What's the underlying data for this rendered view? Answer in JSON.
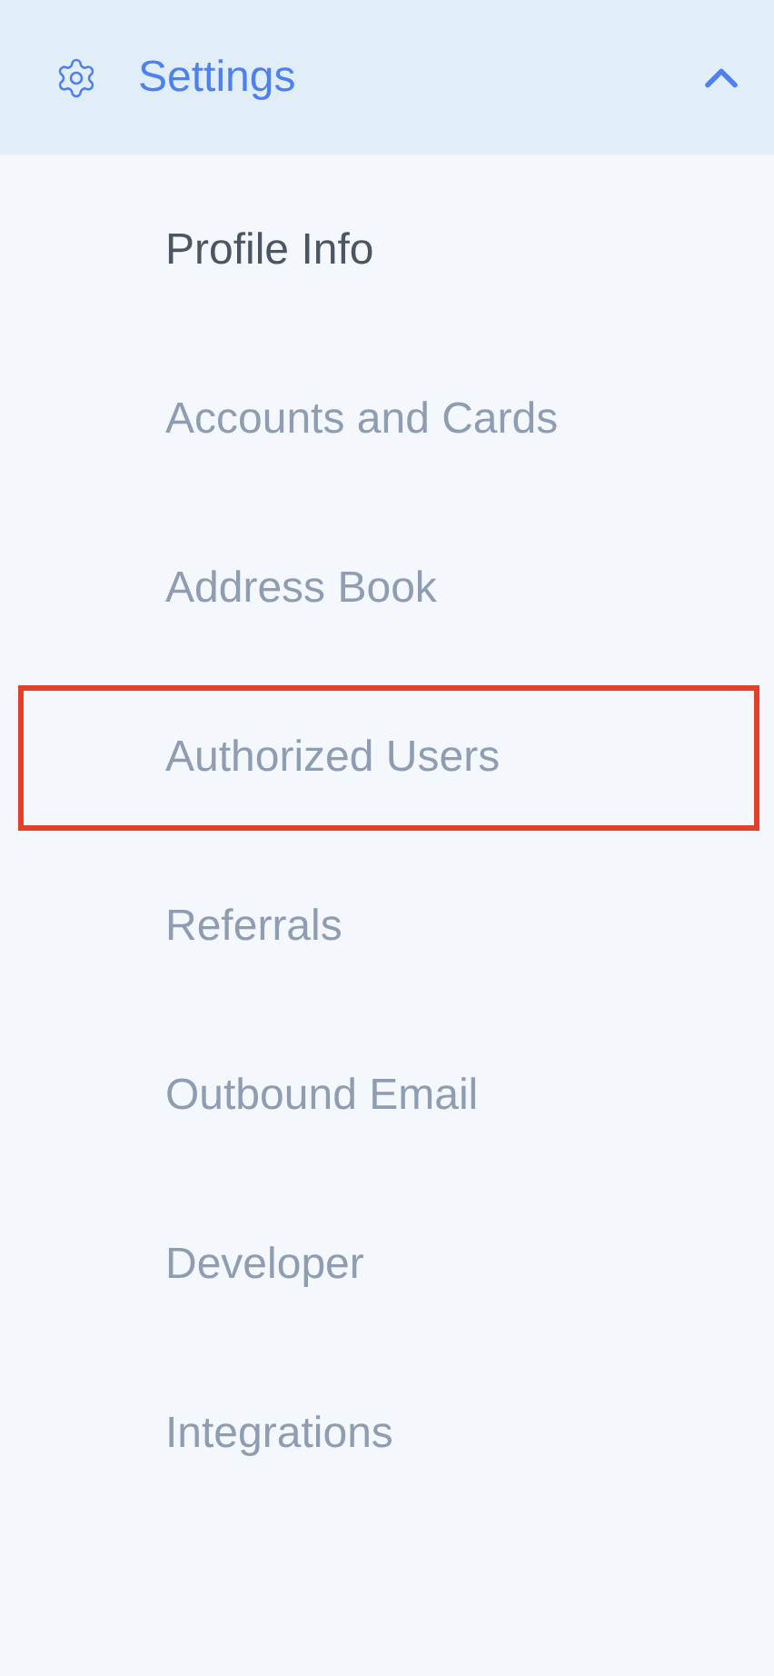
{
  "header": {
    "title": "Settings",
    "expanded": true
  },
  "items": [
    {
      "label": "Profile Info",
      "selected": true,
      "highlighted": false
    },
    {
      "label": "Accounts and Cards",
      "selected": false,
      "highlighted": false
    },
    {
      "label": "Address Book",
      "selected": false,
      "highlighted": false
    },
    {
      "label": "Authorized Users",
      "selected": false,
      "highlighted": true
    },
    {
      "label": "Referrals",
      "selected": false,
      "highlighted": false
    },
    {
      "label": "Outbound Email",
      "selected": false,
      "highlighted": false
    },
    {
      "label": "Developer",
      "selected": false,
      "highlighted": false
    },
    {
      "label": "Integrations",
      "selected": false,
      "highlighted": false
    }
  ]
}
